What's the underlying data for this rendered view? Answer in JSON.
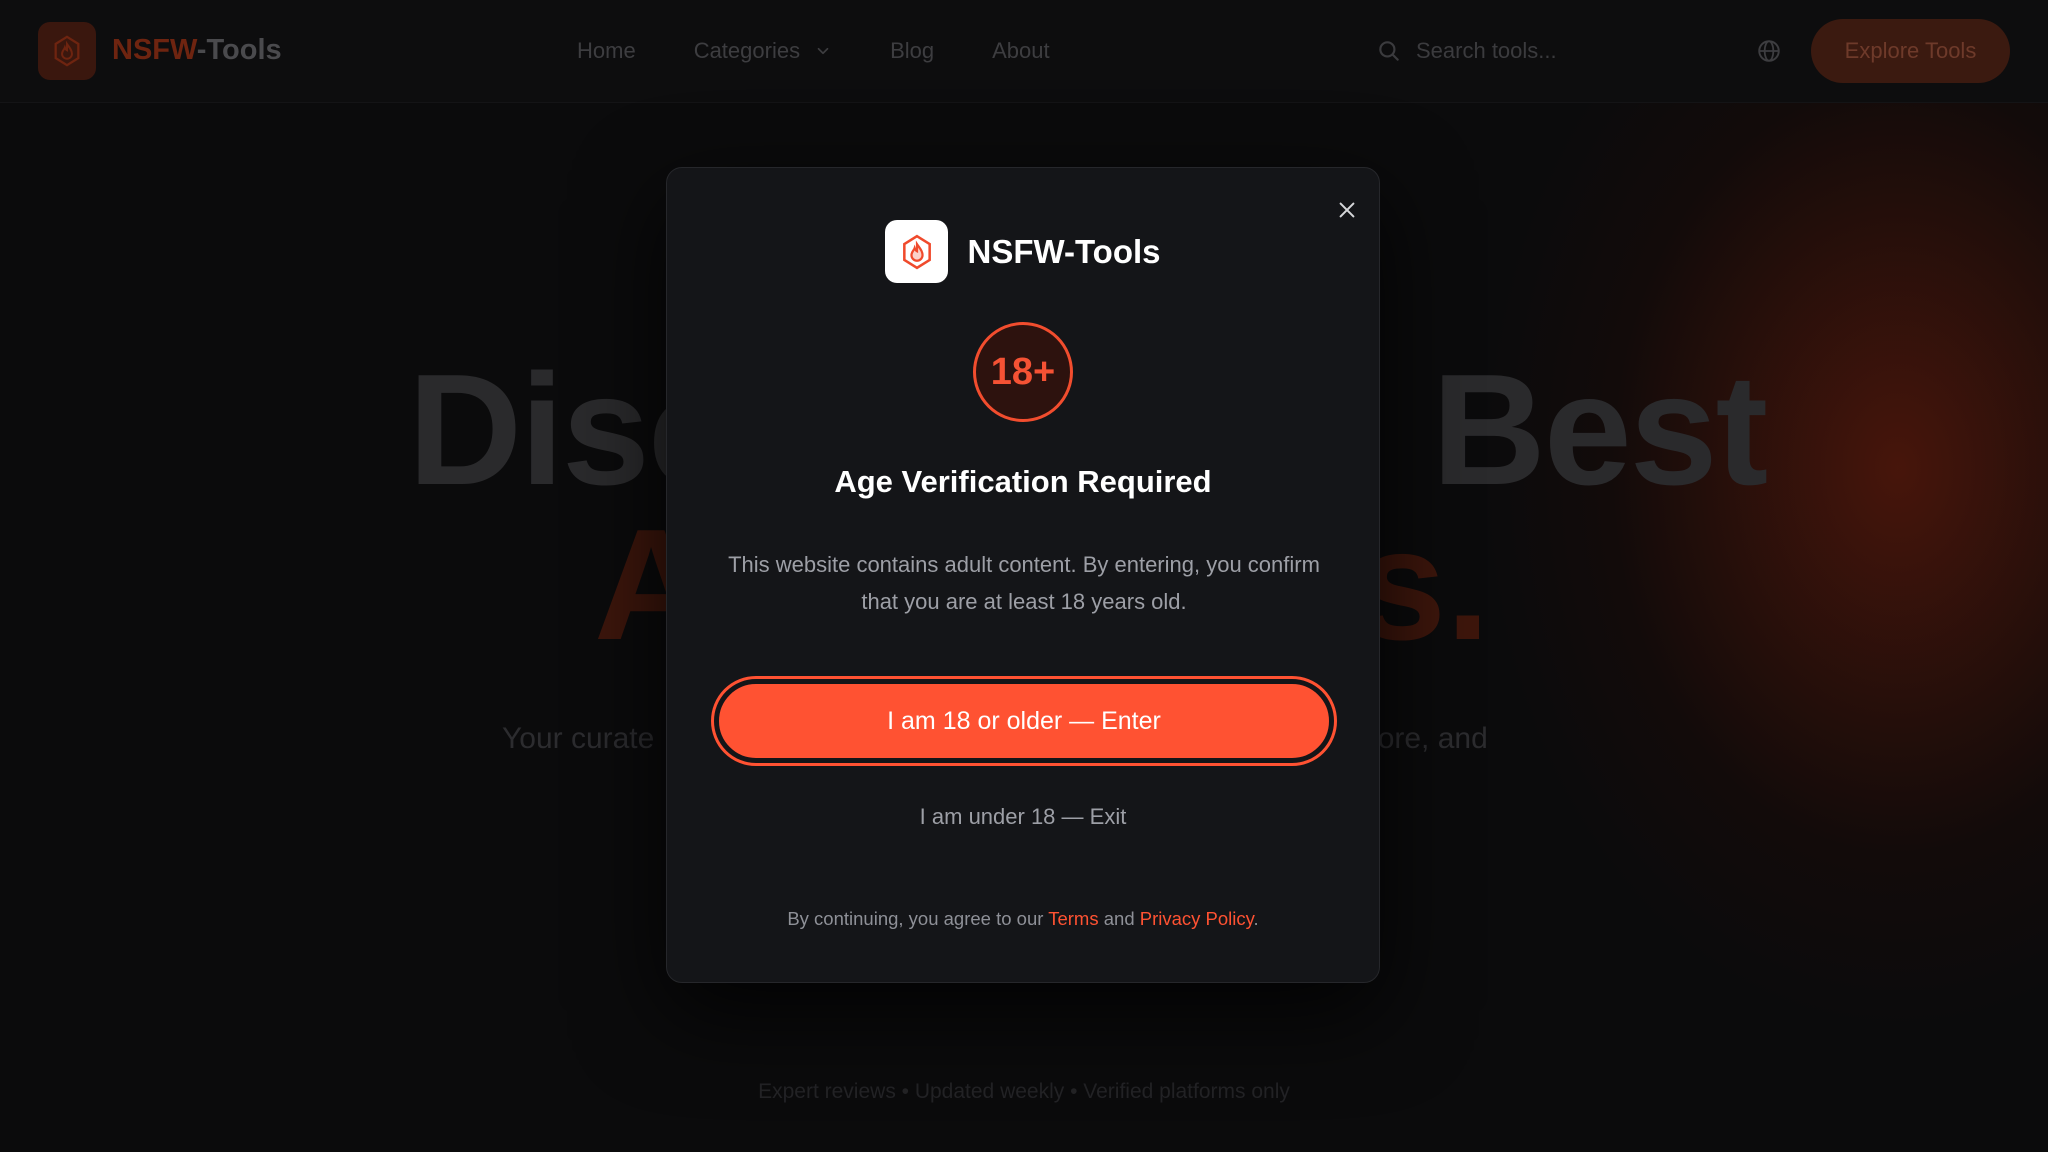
{
  "navbar": {
    "brand_accent": "NSFW",
    "brand_rest": "-Tools",
    "links": [
      "Home",
      "Categories",
      "Blog",
      "About"
    ],
    "search_placeholder": "Search tools...",
    "cta_label": "Explore Tools"
  },
  "hero": {
    "line1_left": "Disc",
    "line1_right": "Best",
    "line2_left": "A",
    "line2_right": "s.",
    "subtitle_left": "Your curate",
    "subtitle_right": "xplore, and",
    "footer_note": "Expert reviews • Updated weekly • Verified platforms only"
  },
  "modal": {
    "brand_name": "NSFW-Tools",
    "badge": "18+",
    "title": "Age Verification Required",
    "body": "This website contains adult content. By entering, you confirm that you are at least 18 years old.",
    "enter_label": "I am 18 or older — Enter",
    "exit_label": "I am under 18 — Exit",
    "legal_prefix": "By continuing, you agree to our",
    "terms_label": "Terms",
    "legal_and": "and",
    "privacy_label": "Privacy Policy",
    "legal_suffix": "."
  },
  "colors": {
    "accent": "#ff5232",
    "modal_bg": "#141518",
    "page_bg": "#0b0b0c"
  },
  "icons": [
    "flame-logo-icon",
    "chevron-down-icon",
    "search-icon",
    "globe-icon",
    "close-icon"
  ]
}
